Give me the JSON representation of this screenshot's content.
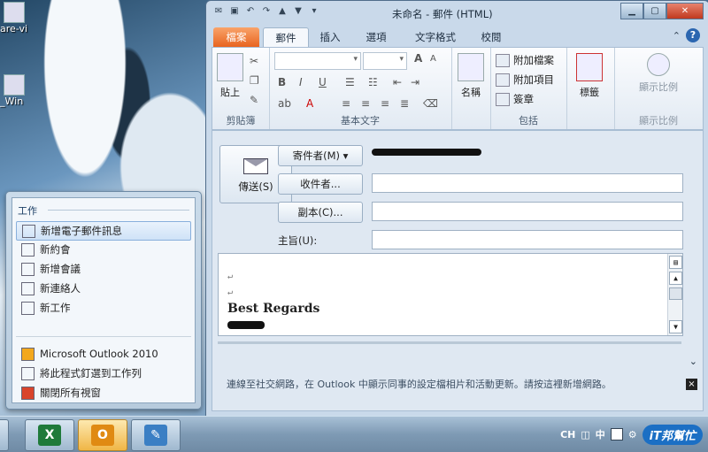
{
  "desktop": {
    "icons": [
      {
        "label": "are-vi",
        "icon": "vmware-icon"
      },
      {
        "label": "_Win",
        "icon": "computer-icon"
      }
    ]
  },
  "window": {
    "title": "未命名 - 郵件 (HTML)",
    "tabs": [
      "檔案",
      "郵件",
      "插入",
      "選項",
      "文字格式",
      "校閱"
    ],
    "ribbon": {
      "clipboard": {
        "paste": "貼上",
        "label": "剪貼簿"
      },
      "basic_text": {
        "label": "基本文字",
        "bold": "B",
        "italic": "I",
        "underline": "U",
        "font_grow": "A",
        "font_shrink": "A"
      },
      "names": {
        "label": "名稱"
      },
      "include": {
        "attach_file": "附加檔案",
        "attach_item": "附加項目",
        "signature": "簽章",
        "label": "包括"
      },
      "tags": {
        "label": "標籤"
      },
      "zoom": {
        "label": "顯示比例",
        "label2": "顯示比例"
      }
    },
    "compose": {
      "send_label": "傳送(S)",
      "from_label": "寄件者(M)",
      "to_label": "收件者...",
      "cc_label": "副本(C)...",
      "subject_label": "主旨(U):",
      "to_value": "",
      "cc_value": "",
      "subject_value": "",
      "body_line": "Best Regards"
    },
    "social_bar": "連線至社交網路，在 Outlook 中顯示同事的設定檔相片和活動更新。請按這裡新增網路。",
    "social_close": "×"
  },
  "jumplist": {
    "section": "工作",
    "tasks": [
      {
        "label": "新增電子郵件訊息",
        "icon": "new-mail-icon",
        "selected": true
      },
      {
        "label": "新約會",
        "icon": "calendar-icon",
        "selected": false
      },
      {
        "label": "新增會議",
        "icon": "meeting-icon",
        "selected": false
      },
      {
        "label": "新連絡人",
        "icon": "contact-icon",
        "selected": false
      },
      {
        "label": "新工作",
        "icon": "task-icon",
        "selected": false
      }
    ],
    "app": {
      "label": "Microsoft Outlook 2010",
      "icon": "outlook-icon"
    },
    "pin": {
      "label": "將此程式釘選到工作列",
      "icon": "pin-icon"
    },
    "close_all": {
      "label": "關閉所有視窗",
      "icon": "close-window-icon"
    }
  },
  "taskbar": {
    "buttons": [
      {
        "name": "excel",
        "glyph": "X",
        "color": "#1f7a3a",
        "active": false
      },
      {
        "name": "outlook",
        "glyph": "O",
        "color": "#e08a12",
        "active": true
      },
      {
        "name": "paint",
        "glyph": "✎",
        "color": "#3b7fc4",
        "active": false
      }
    ],
    "tray": {
      "lang": "CH",
      "ime": "中",
      "brand": "iT邦幫忙"
    }
  }
}
